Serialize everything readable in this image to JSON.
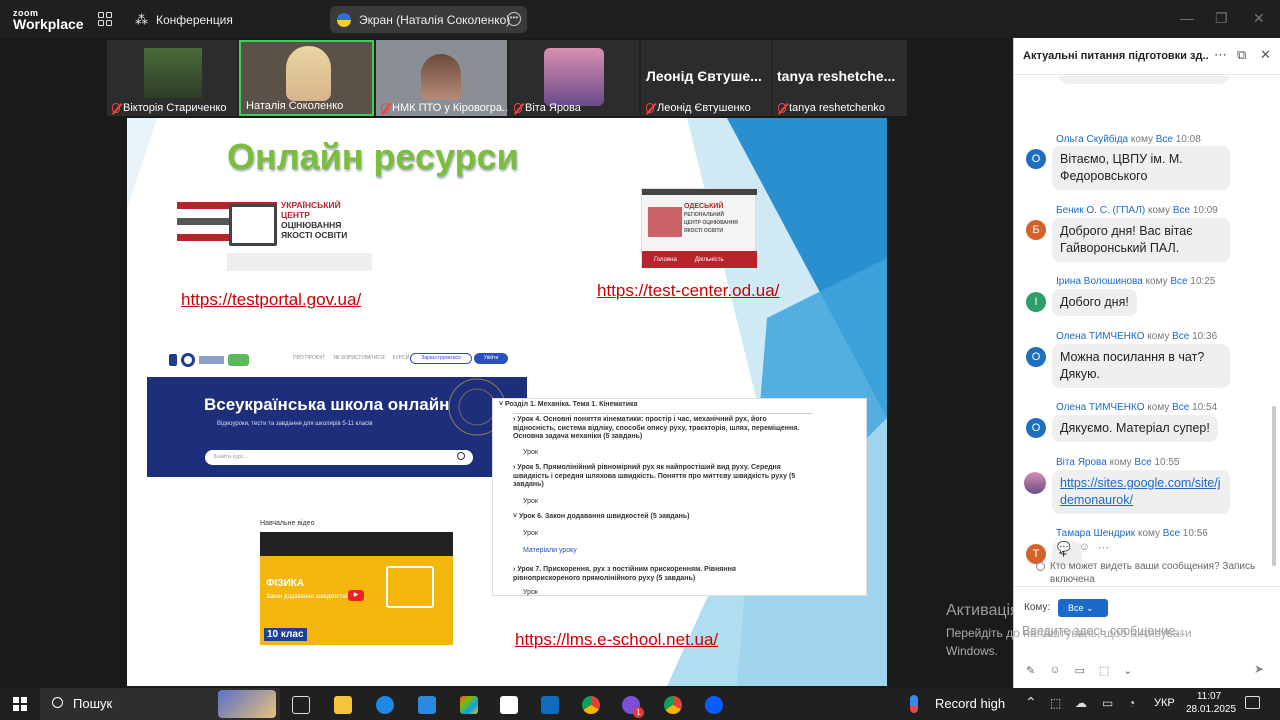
{
  "titlebar": {
    "logo_small": "zoom",
    "logo_big": "Workplace",
    "conference_label": "Конференция",
    "screen_share_label": "Экран (Наталія Соколенко)"
  },
  "participants": [
    {
      "name": "Вікторія Стариченко"
    },
    {
      "name": "Наталія Соколенко"
    },
    {
      "name": "НМК ПТО у Кіровогра..."
    },
    {
      "name": "Віта Ярова"
    },
    {
      "name": "Леонід Євтушенко",
      "big": "Леонід Євтуше..."
    },
    {
      "name": "tanya reshetchenko",
      "big": "tanya  reshetche..."
    }
  ],
  "slide": {
    "title": "Онлайн ресурси",
    "ucoqo_lines": [
      "УКРАЇНСЬКИЙ",
      "ЦЕНТР",
      "ОЦІНЮВАННЯ",
      "ЯКОСТІ ОСВІТИ"
    ],
    "odesa_lines": [
      "ОДЕСЬКИЙ",
      "РЕГІОНАЛЬНИЙ",
      "ЦЕНТР ОЦІНЮВАННЯ",
      "ЯКОСТІ ОСВІТИ"
    ],
    "odesa_nav": [
      "Головна",
      "Діяльність"
    ],
    "link1": "https://testportal.gov.ua/",
    "link2": "https://test-center.od.ua/",
    "link3": "https://lms.e-school.net.ua/",
    "school_nav": [
      "ПРО ПРОЄКТ",
      "ЯК КОРИСТУВАТИСЯ",
      "КУРСИ"
    ],
    "school_register": "Зареєструватися",
    "school_login": "Увійти",
    "school_banner": "Всеукраїнська школа онлайн",
    "school_sub": "Відеоуроки, тести та завдання для школярів 5-11 класів",
    "school_search": "Знайти курс...",
    "lms": {
      "section": "Розділ 1. Механіка. Тема 1. Кінематика",
      "items": [
        {
          "title": "Урок 4. Основні поняття кінематики: простір і час, механічний рух, його відносність, система відліку, способи опису руху, траєкторія, шлях, переміщення. Основна задача механіки (5 завдань)",
          "sub": "Урок"
        },
        {
          "title": "Урок 5. Прямолінійний рівномірний рух як найпростіший вид руху. Середня швидкість і середня шляхова швидкість. Поняття про миттєву швидкість руху (5 завдань)",
          "sub": "Урок"
        },
        {
          "title": "Урок 6. Закон додавання швидкостей (5 завдань)",
          "sub": "Урок",
          "extra": "Матеріали уроку"
        },
        {
          "title": "Урок 7. Прискорення, рух з постійним прискоренням. Рівняння рівноприскореного прямолінійного руху (5 завдань)",
          "sub": "Урок"
        }
      ]
    },
    "video_label": "Навчальне відео",
    "video_subject": "ФІЗИКА",
    "video_topic": "Закон додавання швидкостей",
    "video_grade": "10 клас"
  },
  "chat": {
    "title": "Актуальні питання підготовки зд...",
    "messages": [
      {
        "sender": "Ольга Скуйбіда",
        "to_word": "кому",
        "to": "Все",
        "time": "10:08",
        "initial": "О",
        "color": "#1f6fbf",
        "text": "Вітаємо, ЦВПУ ім. М. Федоровського"
      },
      {
        "sender": "Беник О. С. (ГПАЛ)",
        "to_word": "кому",
        "to": "Все",
        "time": "10:09",
        "initial": "Б",
        "color": "#d4622a",
        "text": "Доброго дня! Вас вітає Гайворонський ПАЛ."
      },
      {
        "sender": "Ірина Волошинова",
        "to_word": "кому",
        "to": "Все",
        "time": "10:25",
        "initial": "І",
        "color": "#2e9e6a",
        "text": "Добого дня!"
      },
      {
        "sender": "Олена ТИМЧЕНКО",
        "to_word": "кому",
        "to": "Все",
        "time": "10:36",
        "initial": "О",
        "color": "#1f6fbf",
        "text": "Можна посилання в чат? Дякую."
      },
      {
        "sender": "Олена ТИМЧЕНКО",
        "to_word": "кому",
        "to": "Все",
        "time": "10:54",
        "initial": "О",
        "color": "#1f6fbf",
        "text": "Дякуємо. Матеріал супер!"
      },
      {
        "sender": "Віта Ярова",
        "to_word": "кому",
        "to": "Все",
        "time": "10:55",
        "initial": "",
        "color": "#9b6a5a",
        "text": "https://sites.google.com/site/jdemonaurok/"
      },
      {
        "sender": "Тамара Шендрик",
        "to_word": "кому",
        "to": "Все",
        "time": "10:56",
        "initial": "Т",
        "color": "#d4622a",
        "text": "+"
      }
    ],
    "privacy_note": "Кто может видеть ваши сообщения? Запись включена",
    "to_label": "Кому:",
    "to_value": "Все",
    "input_placeholder": "Введите здесь сообщение..."
  },
  "watermark": {
    "line1": "Активація Windows",
    "line2": "Перейдіть до налаштувань, щоб активувати",
    "line3": "Windows."
  },
  "taskbar": {
    "search": "Пошук",
    "record": "Record high",
    "lang": "УКР",
    "time": "11:07",
    "date": "28.01.2025",
    "badge": "1"
  }
}
